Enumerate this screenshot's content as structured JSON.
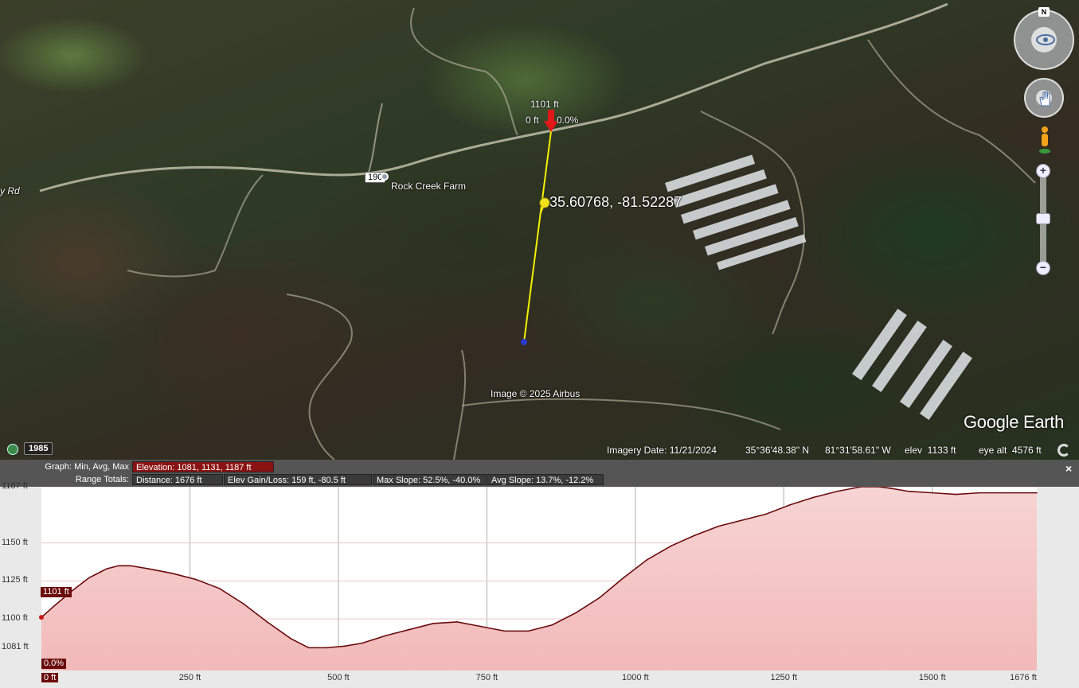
{
  "map": {
    "place_label": "Rock Creek Farm",
    "road_shield": "190",
    "road_fragment": "y Rd",
    "pin_coordinates": "35.60768, -81.52287",
    "cursor_elevation": "1101 ft",
    "cursor_distance": "0 ft",
    "cursor_slope": "0.0%",
    "image_credit": "Image © 2025 Airbus",
    "logo": "Google Earth",
    "north_label": "N",
    "zoom_in_label": "+",
    "zoom_out_label": "−",
    "icons": [
      "clock-icon",
      "look-joystick-icon",
      "move-joystick-icon",
      "pegman-icon",
      "loading-icon",
      "red-arrow-marker-icon",
      "yellow-pushpin-icon"
    ]
  },
  "status": {
    "historical_year": "1985",
    "imagery_date": "Imagery Date: 11/21/2024",
    "latitude": "35°36'48.38\" N",
    "longitude": "81°31'58.61\" W",
    "elevation": "elev  1133 ft",
    "eye_alt": "eye alt  4576 ft"
  },
  "profile": {
    "graph_label": "Graph: Min, Avg, Max",
    "elevation_stats": "Elevation: 1081, 1131, 1187 ft",
    "range_label": "Range Totals:",
    "distance": "Distance: 1676 ft",
    "gain_loss": "Elev Gain/Loss: 159 ft, -80.5 ft",
    "max_slope": "Max Slope: 52.5%, -40.0%",
    "avg_slope": "Avg Slope: 13.7%, -12.2%",
    "close_label": "×",
    "cursor_elev_tag": "1101 ft",
    "cursor_slope_tag": "0.0%"
  },
  "chart_data": {
    "type": "area",
    "xlabel": "",
    "ylabel": "",
    "x_unit": "ft",
    "y_unit": "ft",
    "xlim": [
      0,
      1676
    ],
    "ylim": [
      1066,
      1187
    ],
    "y_ticks": [
      "1187 ft",
      "1150 ft",
      "1125 ft",
      "1100 ft",
      "1081 ft"
    ],
    "y_tick_values": [
      1187,
      1150,
      1125,
      1100,
      1081
    ],
    "x_ticks": [
      "0 ft",
      "250 ft",
      "500 ft",
      "750 ft",
      "1000 ft",
      "1250 ft",
      "1500 ft",
      "1676 ft"
    ],
    "x_tick_values": [
      0,
      250,
      500,
      750,
      1000,
      1250,
      1500,
      1676
    ],
    "series": [
      {
        "x": [
          0,
          20,
          50,
          80,
          110,
          130,
          150,
          180,
          220,
          260,
          300,
          340,
          380,
          420,
          450,
          480,
          510,
          540,
          580,
          620,
          660,
          700,
          740,
          780,
          820,
          860,
          900,
          940,
          980,
          1020,
          1060,
          1100,
          1140,
          1180,
          1220,
          1260,
          1300,
          1340,
          1380,
          1410,
          1430,
          1460,
          1500,
          1540,
          1580,
          1620,
          1676
        ],
        "y": [
          1101,
          1108,
          1118,
          1127,
          1133,
          1135,
          1135,
          1133,
          1130,
          1126,
          1120,
          1110,
          1098,
          1087,
          1081,
          1081,
          1082,
          1084,
          1089,
          1093,
          1097,
          1098,
          1095,
          1092,
          1092,
          1096,
          1104,
          1114,
          1127,
          1139,
          1148,
          1155,
          1161,
          1165,
          1169,
          1175,
          1180,
          1184,
          1187,
          1187,
          1186,
          1184,
          1183,
          1182,
          1183,
          1183,
          1183
        ]
      }
    ],
    "grid": true,
    "fill_color": "#f2b9b9",
    "line_color": "#6a0b0b"
  },
  "colors": {
    "path_line": "#f4f000",
    "profile_highlight": "#8b1212",
    "header_bg": "#555555"
  }
}
